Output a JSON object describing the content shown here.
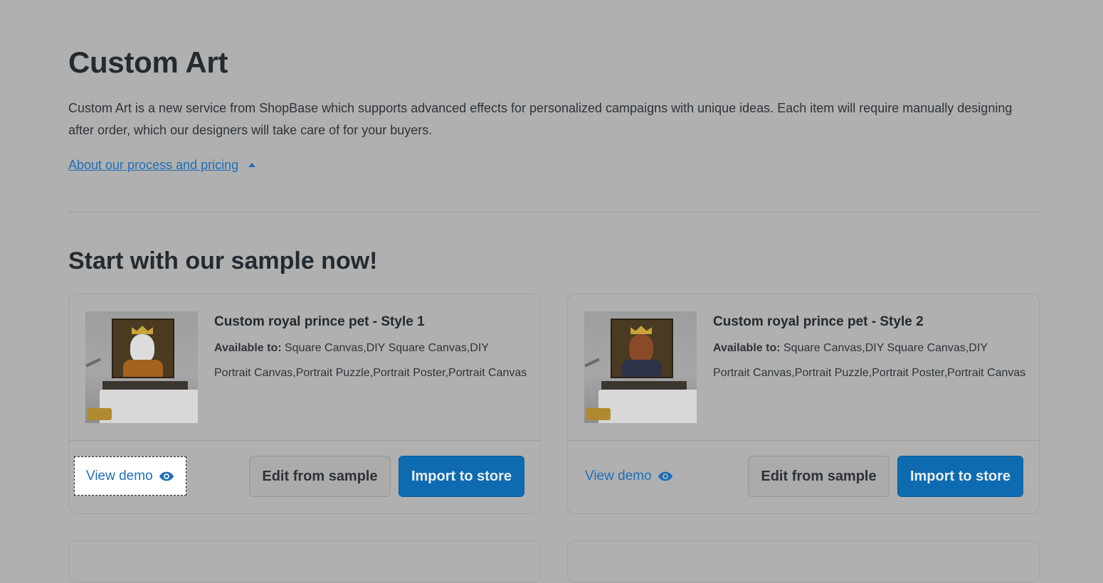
{
  "header": {
    "title": "Custom Art",
    "description": "Custom Art is a new service from ShopBase which supports advanced effects for personalized campaigns with unique ideas. Each item will require manually designing after order, which our designers will take care of for your buyers.",
    "about_link": "About our process and pricing"
  },
  "samples_section": {
    "title": "Start with our sample now!",
    "cards": [
      {
        "name": "Custom royal prince pet - Style 1",
        "available_label": "Available to:",
        "available_value": "Square Canvas,DIY Square Canvas,DIY Portrait Canvas,Portrait Puzzle,Portrait Poster,Portrait Canvas",
        "view_demo": "View demo",
        "edit_button": "Edit from sample",
        "import_button": "Import to store"
      },
      {
        "name": "Custom royal prince pet - Style 2",
        "available_label": "Available to:",
        "available_value": "Square Canvas,DIY Square Canvas,DIY Portrait Canvas,Portrait Puzzle,Portrait Poster,Portrait Canvas",
        "view_demo": "View demo",
        "edit_button": "Edit from sample",
        "import_button": "Import to store"
      }
    ]
  },
  "icons": {
    "about_toggle": "caret-up-icon",
    "view_demo": "eye-icon"
  },
  "colors": {
    "overlay_background": "#b0b0b0",
    "link": "#1e6fb8",
    "primary_button": "#0e6bb0"
  }
}
